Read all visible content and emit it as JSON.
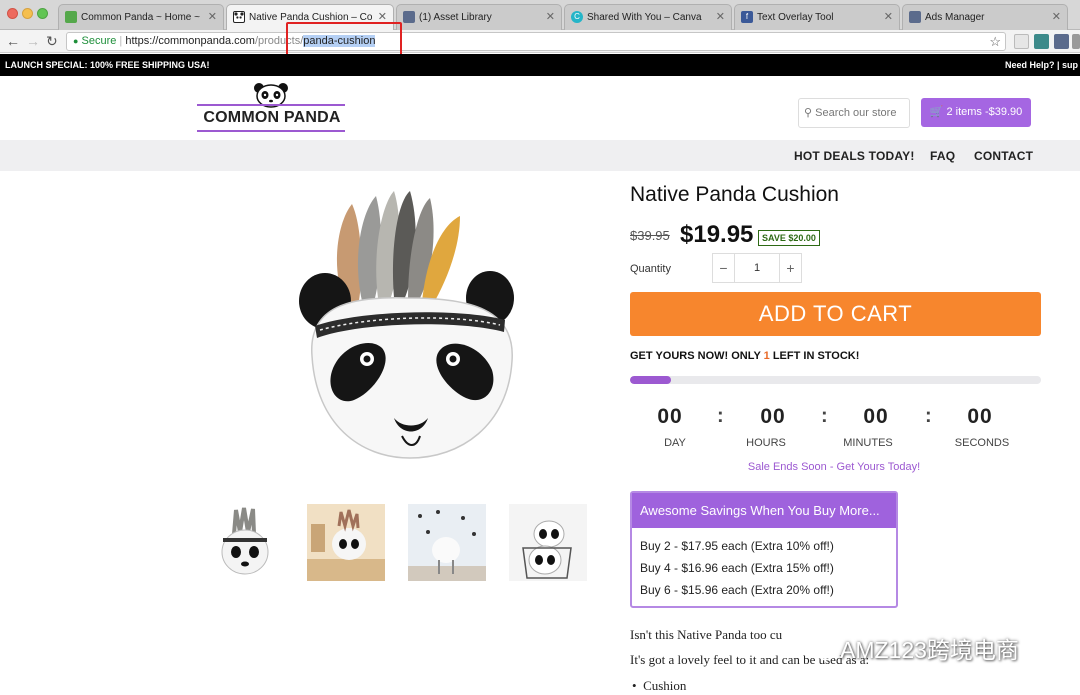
{
  "browser": {
    "tabs": [
      {
        "title": "Common Panda ~ Home ~ Sho",
        "fav_color": "#55a84b",
        "fav_glyph": "",
        "active": false
      },
      {
        "title": "Native Panda Cushion – Comm",
        "fav_color": "#222222",
        "fav_glyph": "",
        "active": true
      },
      {
        "title": "(1) Asset Library",
        "fav_color": "#5b6b8c",
        "fav_glyph": "",
        "active": false
      },
      {
        "title": "Shared With You – Canva",
        "fav_color": "#25b5c8",
        "fav_glyph": "C",
        "active": false
      },
      {
        "title": "Text Overlay Tool",
        "fav_color": "#3b5998",
        "fav_glyph": "f",
        "active": false
      },
      {
        "title": "Ads Manager",
        "fav_color": "#5b6b8c",
        "fav_glyph": "",
        "active": false
      }
    ],
    "secure_label": "Secure",
    "url_host": "https://commonpanda.com",
    "url_path": "/products/",
    "url_selected": "panda-cushion"
  },
  "announcement": {
    "left": "LAUNCH SPECIAL: 100% FREE SHIPPING USA!",
    "right": "Need Help? | sup"
  },
  "header": {
    "logo_text": "COMMON PANDA",
    "search_placeholder": "Search our store",
    "cart_label": "2 items -$39.90",
    "nav": [
      "HOT DEALS TODAY!",
      "FAQ",
      "CONTACT"
    ]
  },
  "product": {
    "title": "Native Panda Cushion",
    "old_price": "$39.95",
    "price": "$19.95",
    "save_badge": "SAVE $20.00",
    "quantity_label": "Quantity",
    "quantity": "1",
    "add_to_cart": "ADD TO CART",
    "stock_prefix": "GET YOURS NOW! ONLY ",
    "stock_count": "1",
    "stock_suffix": " LEFT IN STOCK!",
    "stock_progress": 0.1
  },
  "countdown": {
    "units": [
      {
        "value": "00",
        "label": "DAY"
      },
      {
        "value": "00",
        "label": "HOURS"
      },
      {
        "value": "00",
        "label": "MINUTES"
      },
      {
        "value": "00",
        "label": "SECONDS"
      }
    ],
    "sale_text": "Sale Ends Soon - Get Yours Today!"
  },
  "savings": {
    "heading": "Awesome Savings When You Buy More...",
    "rows": [
      "Buy 2 - $17.95 each (Extra 10% off!)",
      "Buy 4 - $16.96 each (Extra 15% off!)",
      "Buy 6 - $15.96 each (Extra 20% off!)"
    ]
  },
  "description": {
    "line1": "Isn't this Native Panda too cu",
    "line2": "It's got a lovely feel to it and can be used as a:",
    "bullet1": "Cushion"
  },
  "watermark": "AMZ123跨境电商",
  "colors": {
    "accent_purple": "#9c59d1",
    "add_to_cart_orange": "#f7862d",
    "save_green": "#2d6a14"
  }
}
